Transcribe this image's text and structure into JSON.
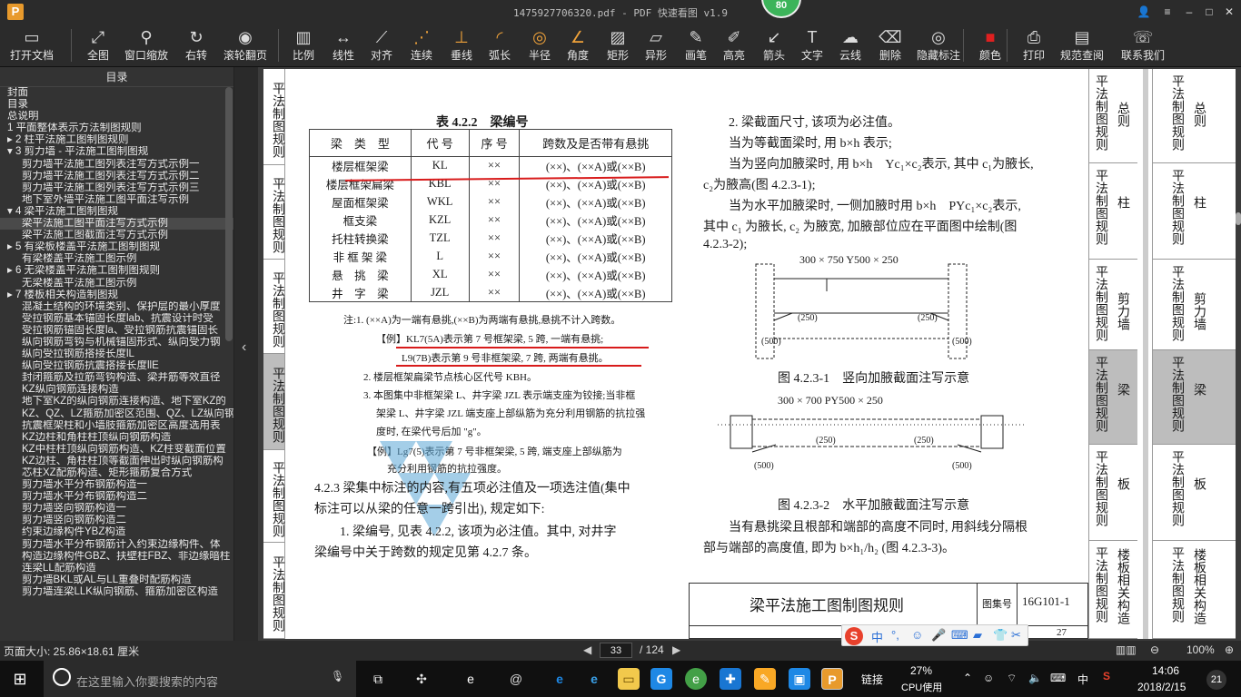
{
  "titlebar": {
    "title": "1475927706320.pdf - PDF 快速看图 v1.9",
    "score": "80",
    "logo": "P"
  },
  "toolbar": {
    "items": [
      {
        "label": "打开文档",
        "icon": "folder-icon",
        "glyph": "▭"
      },
      {
        "label": "全图",
        "icon": "fit-icon",
        "glyph": "⤢"
      },
      {
        "label": "窗口缩放",
        "icon": "zoom-icon",
        "glyph": "⚲"
      },
      {
        "label": "右转",
        "icon": "rotate-icon",
        "glyph": "↻"
      },
      {
        "label": "滚轮翻页",
        "icon": "mouse-icon",
        "glyph": "◉"
      },
      {
        "label": "比例",
        "icon": "scale-icon",
        "glyph": "▥"
      },
      {
        "label": "线性",
        "icon": "linear-icon",
        "glyph": "↔"
      },
      {
        "label": "对齐",
        "icon": "align-icon",
        "glyph": "⟋"
      },
      {
        "label": "连续",
        "icon": "continuous-icon",
        "glyph": "⋰"
      },
      {
        "label": "垂线",
        "icon": "perpendicular-icon",
        "glyph": "⊥"
      },
      {
        "label": "弧长",
        "icon": "arc-icon",
        "glyph": "◜"
      },
      {
        "label": "半径",
        "icon": "radius-icon",
        "glyph": "◎"
      },
      {
        "label": "角度",
        "icon": "angle-icon",
        "glyph": "∠"
      },
      {
        "label": "矩形",
        "icon": "rect-icon",
        "glyph": "▨"
      },
      {
        "label": "异形",
        "icon": "polygon-icon",
        "glyph": "▱"
      },
      {
        "label": "画笔",
        "icon": "pen-icon",
        "glyph": "✎"
      },
      {
        "label": "高亮",
        "icon": "highlight-icon",
        "glyph": "✐"
      },
      {
        "label": "箭头",
        "icon": "arrow-icon",
        "glyph": "↙"
      },
      {
        "label": "文字",
        "icon": "text-icon",
        "glyph": "T"
      },
      {
        "label": "云线",
        "icon": "cloud-icon",
        "glyph": "☁"
      },
      {
        "label": "删除",
        "icon": "eraser-icon",
        "glyph": "⌫"
      },
      {
        "label": "隐藏标注",
        "icon": "eye-hide-icon",
        "glyph": "◎"
      },
      {
        "label": "颜色",
        "icon": "color-icon",
        "glyph": "■"
      },
      {
        "label": "打印",
        "icon": "print-icon",
        "glyph": "⎙"
      },
      {
        "label": "规范查阅",
        "icon": "book-icon",
        "glyph": "▤"
      },
      {
        "label": "联系我们",
        "icon": "contact-icon",
        "glyph": "☏"
      }
    ]
  },
  "sidebar": {
    "title": "目录",
    "items": [
      {
        "t": "封面",
        "s": true
      },
      {
        "t": "目录",
        "s": true
      },
      {
        "t": "总说明",
        "s": true
      },
      {
        "t": "1 平面整体表示方法制图规则",
        "s": true
      },
      {
        "t": "▸ 2 柱平法施工图制图规则",
        "s": true
      },
      {
        "t": "▾ 3 剪力墙 - 平法施工图制图规",
        "s": true
      },
      {
        "t": "剪力墙平法施工图列表注写方式示例一"
      },
      {
        "t": "剪力墙平法施工图列表注写方式示例二"
      },
      {
        "t": "剪力墙平法施工图列表注写方式示例三"
      },
      {
        "t": "地下室外墙平法施工图平面注写示例"
      },
      {
        "t": "▾ 4 梁平法施工图制图规",
        "s": true
      },
      {
        "t": "梁平法施工图平面注写方式示例",
        "sel": true
      },
      {
        "t": "梁平法施工图截面注写方式示例"
      },
      {
        "t": "▸ 5 有梁板楼盖平法施工图制图规",
        "s": true
      },
      {
        "t": "有梁楼盖平法施工图示例"
      },
      {
        "t": "▸ 6 无梁楼盖平法施工图制图规则",
        "s": true
      },
      {
        "t": "无梁楼盖平法施工图示例"
      },
      {
        "t": "▸ 7 楼板相关构造制图规",
        "s": true
      },
      {
        "t": "混凝土结构的环境类别、保护层的最小厚度"
      },
      {
        "t": "受拉钢筋基本锚固长度lab、抗震设计时受"
      },
      {
        "t": "受拉钢筋锚固长度la、受拉钢筋抗震锚固长"
      },
      {
        "t": "纵向钢筋弯钩与机械锚固形式、纵向受力钢"
      },
      {
        "t": "纵向受拉钢筋搭接长度lL"
      },
      {
        "t": "纵向受拉钢筋抗震搭接长度llE"
      },
      {
        "t": "封闭箍筋及拉筋弯钩构造、梁并筋等效直径"
      },
      {
        "t": "KZ纵向钢筋连接构造"
      },
      {
        "t": "地下室KZ的纵向钢筋连接构造、地下室KZ的"
      },
      {
        "t": "KZ、QZ、LZ箍筋加密区范围、QZ、LZ纵向钢"
      },
      {
        "t": "抗震框架柱和小墙肢箍筋加密区高度选用表"
      },
      {
        "t": "KZ边柱和角柱柱顶纵向钢筋构造"
      },
      {
        "t": "KZ中柱柱顶纵向钢筋构造、KZ柱变截面位置"
      },
      {
        "t": "KZ边柱、角柱柱顶等截面伸出时纵向钢筋构"
      },
      {
        "t": "芯柱XZ配筋构造、矩形箍筋复合方式"
      },
      {
        "t": "剪力墙水平分布钢筋构造一"
      },
      {
        "t": "剪力墙水平分布钢筋构造二"
      },
      {
        "t": "剪力墙竖向钢筋构造一"
      },
      {
        "t": "剪力墙竖向钢筋构造二"
      },
      {
        "t": "约束边缘构件YBZ构造"
      },
      {
        "t": "剪力墙水平分布钢筋计入约束边缘构件、体"
      },
      {
        "t": "构造边缘构件GBZ、扶壁柱FBZ、非边缘暗柱"
      },
      {
        "t": "连梁LL配筋构造"
      },
      {
        "t": "剪力墙BKL或AL与LL重叠时配筋构造"
      },
      {
        "t": "剪力墙连梁LLK纵向钢筋、箍筋加密区构造"
      }
    ]
  },
  "page": {
    "left_tabs": [
      "平法制图规则",
      "平法制图规则",
      "平法制图规则",
      "平法制图规则",
      "平法制图规则",
      "平法制图规则"
    ],
    "table_caption": "表 4.2.2　梁编号",
    "table_headers": [
      "梁　类　型",
      "代 号",
      "序 号",
      "跨数及是否带有悬挑"
    ],
    "table_rows": [
      [
        "楼层框架梁",
        "KL",
        "××",
        "(××)、(××A)或(××B)"
      ],
      [
        "楼层框架扁梁",
        "KBL",
        "××",
        "(××)、(××A)或(××B)"
      ],
      [
        "屋面框架梁",
        "WKL",
        "××",
        "(××)、(××A)或(××B)"
      ],
      [
        "框支梁",
        "KZL",
        "××",
        "(××)、(××A)或(××B)"
      ],
      [
        "托柱转换梁",
        "TZL",
        "××",
        "(××)、(××A)或(××B)"
      ],
      [
        "非 框 架 梁",
        "L",
        "××",
        "(××)、(××A)或(××B)"
      ],
      [
        "悬　挑　梁",
        "XL",
        "××",
        "(××)、(××A)或(××B)"
      ],
      [
        "井　字　梁",
        "JZL",
        "××",
        "(××)、(××A)或(××B)"
      ]
    ],
    "note1": "注:1. (××A)为一端有悬挑,(××B)为两端有悬挑,悬挑不计入跨数。",
    "example1": "【例】KL7(5A)表示第 7 号框架梁, 5 跨, 一端有悬挑;",
    "example2": "L9(7B)表示第 9 号非框架梁, 7 跨, 两端有悬挑。",
    "note2": "2. 楼层框架扁梁节点核心区代号 KBH。",
    "note3a": "3. 本图集中非框架梁 L、井字梁 JZL 表示端支座为铰接;当非框",
    "note3b": "架梁 L、井字梁 JZL 端支座上部纵筋为充分利用钢筋的抗拉强",
    "note3c": "度时, 在梁代号后加 \"g\"。",
    "example3a": "【例】Lg7(5)表示第 7 号非框架梁, 5 跨, 端支座上部纵筋为",
    "example3b": "充分利用钢筋的抗拉强度。",
    "sec423a": "4.2.3 梁集中标注的内容,有五项必注值及一项选注值(集中",
    "sec423b": "标注可以从梁的任意一跨引出), 规定如下:",
    "item1a": "1. 梁编号, 见表 4.2.2, 该项为必注值。其中, 对井字",
    "item1b": "梁编号中关于跨数的规定见第 4.2.7 条。",
    "r1": "2. 梁截面尺寸, 该项为必注值。",
    "r2": "当为等截面梁时, 用 b×h 表示;",
    "r3": "当为竖向加腋梁时, 用 b×h　Yc₁×c₂表示, 其中 c₁为腋长,",
    "r4": "c₂为腋高(图 4.2.3-1);",
    "r5": "当为水平加腋梁时, 一侧加腋时用 b×h　PYc₁×c₂表示,",
    "r6": "其中 c₁ 为腋长, c₂ 为腋宽, 加腋部位应在平面图中绘制(图",
    "r7": "4.2.3-2);",
    "fig1_label": "300 × 750  Y500 × 250",
    "fig1_caption": "图 4.2.3-1　竖向加腋截面注写示意",
    "fig2_label": "300 × 700  PY500 × 250",
    "fig2_caption": "图 4.2.3-2　水平加腋截面注写示意",
    "dim500": "(500)",
    "dim250": "(250)",
    "c1": "c₁",
    "c2": "c₂",
    "r8": "当有悬挑梁且根部和端部的高度不同时, 用斜线分隔根",
    "r9": "部与端部的高度值, 即为 b×h₁/h₂ (图 4.2.3-3)。",
    "footer_title": "梁平法施工图制图规则",
    "footer_label": "图集号",
    "footer_code": "16G101-1",
    "footer_page": "27",
    "right_tabs": [
      "总则",
      "柱",
      "剪力墙",
      "梁",
      "板",
      "楼板相关构造"
    ],
    "right_tab_prefix": "平法制图规则"
  },
  "statusbar": {
    "page_size": "页面大小: 25.86×18.61 厘米",
    "page_current": "33",
    "page_total": "/ 124",
    "zoom": "100%"
  },
  "taskbar": {
    "search_placeholder": "在这里输入你要搜索的内容",
    "link": "链接",
    "cpu": "27%",
    "cpu_label": "CPU使用",
    "ime": "中",
    "time": "14:06",
    "date": "2018/2/15",
    "notif": "21"
  }
}
